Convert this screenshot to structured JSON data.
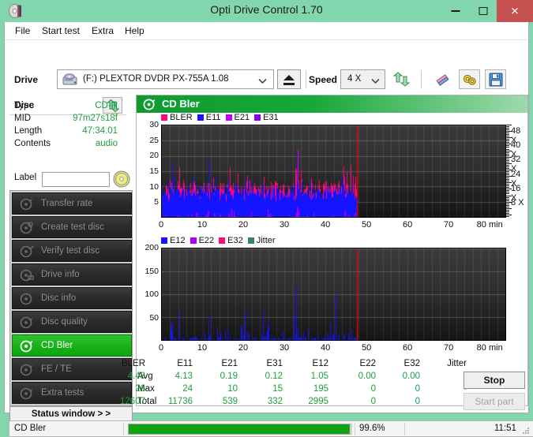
{
  "window": {
    "title": "Opti Drive Control 1.70",
    "icon": "disc-icon",
    "controls": {
      "minimize": "minimize-icon",
      "maximize": "maximize-icon",
      "close": "close-icon"
    },
    "titlebar_color": "#82d6ad",
    "close_color": "#c75050"
  },
  "menu": [
    {
      "label": "File"
    },
    {
      "label": "Start test"
    },
    {
      "label": "Extra"
    },
    {
      "label": "Help"
    }
  ],
  "toolbar": {
    "drive_label": "Drive",
    "drive_value": "(F:)   PLEXTOR DVDR   PX-755A 1.08",
    "drive_icon": "drive-icon",
    "eject_icon": "eject-icon",
    "speed_label": "Speed",
    "speed_value": "4 X",
    "refresh_icon": "refresh-icon",
    "erase_icon": "erase-icon",
    "settings_icon": "settings-icon",
    "save_icon": "save-icon"
  },
  "disc": {
    "header": "Disc",
    "swap_icon": "swap-icon",
    "rows": [
      {
        "key": "Type",
        "value": "CD-R"
      },
      {
        "key": "MID",
        "value": "97m27s18f"
      },
      {
        "key": "Length",
        "value": "47:34.01"
      },
      {
        "key": "Contents",
        "value": "audio"
      }
    ],
    "label_key": "Label",
    "label_value": "",
    "label_placeholder": "",
    "label_button_icon": "cd-icon"
  },
  "nav": {
    "items": [
      {
        "label": "Transfer rate",
        "icon": "disc-icon",
        "active": false
      },
      {
        "label": "Create test disc",
        "icon": "disc-icon",
        "active": false
      },
      {
        "label": "Verify test disc",
        "icon": "disc-icon",
        "active": false
      },
      {
        "label": "Drive info",
        "icon": "disc-icon",
        "active": false
      },
      {
        "label": "Disc info",
        "icon": "disc-icon",
        "active": false
      },
      {
        "label": "Disc quality",
        "icon": "disc-icon",
        "active": false
      },
      {
        "label": "CD Bler",
        "icon": "disc-icon",
        "active": true
      },
      {
        "label": "FE / TE",
        "icon": "disc-icon",
        "active": false
      },
      {
        "label": "Extra tests",
        "icon": "disc-icon",
        "active": false
      }
    ],
    "status_window": "Status window > >"
  },
  "panel": {
    "title": "CD Bler",
    "icon": "disc-icon"
  },
  "chart_data": [
    {
      "id": "bler-chart",
      "type": "line",
      "title": "CD Bler",
      "xlabel": "80 min",
      "ylabel": "",
      "xlim": [
        0,
        84
      ],
      "ylim": [
        0,
        30
      ],
      "xticks": [
        0,
        10,
        20,
        30,
        40,
        50,
        60,
        70,
        80
      ],
      "xticklabels": [
        "0",
        "10",
        "20",
        "30",
        "40",
        "50",
        "60",
        "70",
        "80 min"
      ],
      "yticks": [
        5,
        10,
        15,
        20,
        25,
        30
      ],
      "yticklabels": [
        "5",
        "10",
        "15",
        "20",
        "25",
        "30"
      ],
      "right_axis": {
        "label": "speed",
        "ticks": [
          8,
          16,
          24,
          32,
          40,
          48
        ],
        "ticklabels": [
          "8 X",
          "16 X",
          "24 X",
          "32 X",
          "40 X",
          "48 X"
        ],
        "lim": [
          0,
          52
        ]
      },
      "grid": true,
      "legend": [
        {
          "name": "BLER",
          "color": "#ff0a78"
        },
        {
          "name": "E11",
          "color": "#1414ff"
        },
        {
          "name": "E21",
          "color": "#c000ff"
        },
        {
          "name": "E31",
          "color": "#8800ee"
        }
      ],
      "data_end_min": 47.6,
      "end_marker_color": "#ff0000",
      "series": [
        {
          "name": "BLER",
          "color": "#ff0a78",
          "baseline_mean": 9.5,
          "peaks": [
            [
              1.2,
              12
            ],
            [
              1.9,
              15
            ],
            [
              2.4,
              21
            ],
            [
              2.8,
              18
            ],
            [
              3.6,
              14
            ],
            [
              4.3,
              23
            ],
            [
              5.2,
              13
            ],
            [
              6.1,
              12
            ],
            [
              7.4,
              14
            ],
            [
              7.9,
              13
            ],
            [
              8.6,
              12
            ],
            [
              9.4,
              11
            ],
            [
              10.2,
              14
            ],
            [
              11.3,
              25
            ],
            [
              11.9,
              17
            ],
            [
              12.5,
              18
            ],
            [
              13.4,
              13
            ],
            [
              14.2,
              12
            ],
            [
              15.1,
              14
            ],
            [
              15.8,
              13
            ],
            [
              16.6,
              17
            ],
            [
              17.3,
              20
            ],
            [
              17.9,
              15
            ],
            [
              18.6,
              22
            ],
            [
              19.4,
              14
            ],
            [
              20.2,
              15
            ],
            [
              20.9,
              18
            ],
            [
              21.5,
              19
            ],
            [
              22.3,
              13
            ],
            [
              23.1,
              12
            ],
            [
              24.2,
              16
            ],
            [
              24.9,
              14
            ],
            [
              25.6,
              16
            ],
            [
              26.2,
              15
            ],
            [
              27.1,
              12
            ],
            [
              28.0,
              11
            ],
            [
              29.3,
              12
            ],
            [
              30.4,
              13
            ],
            [
              31.2,
              14
            ],
            [
              32.0,
              16
            ],
            [
              32.6,
              20
            ],
            [
              32.9,
              26
            ],
            [
              33.2,
              24
            ],
            [
              33.5,
              21
            ],
            [
              34.0,
              17
            ],
            [
              34.8,
              12
            ],
            [
              35.6,
              11
            ],
            [
              36.5,
              13
            ],
            [
              37.4,
              11
            ],
            [
              38.2,
              10
            ],
            [
              39.5,
              12
            ],
            [
              40.6,
              12
            ],
            [
              41.3,
              13
            ],
            [
              42.4,
              14
            ],
            [
              43.1,
              11
            ],
            [
              44.5,
              32
            ],
            [
              45.2,
              16
            ],
            [
              46.1,
              24
            ],
            [
              46.8,
              22
            ],
            [
              47.3,
              14
            ]
          ]
        },
        {
          "name": "E11",
          "color": "#1414ff",
          "baseline_mean": 8.5,
          "peaks": [
            [
              1.1,
              11
            ],
            [
              2.2,
              20
            ],
            [
              2.5,
              19
            ],
            [
              3.1,
              14
            ],
            [
              4.0,
              13
            ],
            [
              5.0,
              12
            ],
            [
              6.3,
              11
            ],
            [
              7.5,
              16
            ],
            [
              8.2,
              14
            ],
            [
              9.1,
              12
            ],
            [
              10.4,
              13
            ],
            [
              11.4,
              19
            ],
            [
              12.2,
              14
            ],
            [
              13.1,
              16
            ],
            [
              14.0,
              12
            ],
            [
              15.3,
              13
            ],
            [
              16.2,
              14
            ],
            [
              17.1,
              13
            ],
            [
              18.2,
              15
            ],
            [
              19.0,
              13
            ],
            [
              20.3,
              14
            ],
            [
              21.2,
              16
            ],
            [
              22.0,
              12
            ],
            [
              23.5,
              11
            ],
            [
              24.5,
              13
            ],
            [
              25.4,
              12
            ],
            [
              26.0,
              14
            ],
            [
              27.3,
              11
            ],
            [
              28.6,
              10
            ],
            [
              30.0,
              11
            ],
            [
              31.5,
              12
            ],
            [
              32.4,
              14
            ],
            [
              33.0,
              24
            ],
            [
              33.3,
              22
            ],
            [
              34.2,
              13
            ],
            [
              35.0,
              11
            ],
            [
              36.3,
              12
            ],
            [
              37.1,
              11
            ],
            [
              38.4,
              10
            ],
            [
              40.0,
              11
            ],
            [
              41.1,
              12
            ],
            [
              42.6,
              13
            ],
            [
              44.0,
              16
            ],
            [
              45.5,
              12
            ],
            [
              46.5,
              14
            ],
            [
              47.2,
              11
            ]
          ]
        },
        {
          "name": "E21",
          "color": "#c000ff",
          "baseline_mean": 0.19,
          "peaks": [
            [
              11.3,
              4
            ],
            [
              17.0,
              3
            ],
            [
              17.5,
              3
            ],
            [
              25.9,
              3
            ],
            [
              33.1,
              6
            ],
            [
              33.3,
              5
            ],
            [
              44.8,
              2
            ]
          ]
        },
        {
          "name": "E31",
          "color": "#8800ee",
          "baseline_mean": 0.12,
          "peaks": [
            [
              11.2,
              2
            ],
            [
              16.8,
              2
            ],
            [
              33.2,
              3
            ],
            [
              44.6,
              2
            ]
          ]
        }
      ]
    },
    {
      "id": "e12-chart",
      "type": "line",
      "title": "",
      "xlabel": "80 min",
      "ylabel": "",
      "xlim": [
        0,
        84
      ],
      "ylim": [
        0,
        200
      ],
      "xticks": [
        0,
        10,
        20,
        30,
        40,
        50,
        60,
        70,
        80
      ],
      "xticklabels": [
        "0",
        "10",
        "20",
        "30",
        "40",
        "50",
        "60",
        "70",
        "80 min"
      ],
      "yticks": [
        50,
        100,
        150,
        200
      ],
      "yticklabels": [
        "50",
        "100",
        "150",
        "200"
      ],
      "grid": true,
      "legend": [
        {
          "name": "E12",
          "color": "#1414ff"
        },
        {
          "name": "E22",
          "color": "#a800ff"
        },
        {
          "name": "E32",
          "color": "#ff0a78"
        },
        {
          "name": "Jitter",
          "color": "#3d7d78"
        }
      ],
      "data_end_min": 47.6,
      "end_marker_color": "#ff0000",
      "series": [
        {
          "name": "E12",
          "color": "#1414ff",
          "baseline_mean": 2,
          "peaks": [
            [
              2.2,
              66
            ],
            [
              2.5,
              40
            ],
            [
              3.0,
              10
            ],
            [
              4.3,
              88
            ],
            [
              5.1,
              6
            ],
            [
              7.6,
              12
            ],
            [
              8.2,
              14
            ],
            [
              8.6,
              6
            ],
            [
              9.5,
              8
            ],
            [
              10.4,
              18
            ],
            [
              11.4,
              54
            ],
            [
              11.8,
              12
            ],
            [
              12.8,
              6
            ],
            [
              13.5,
              30
            ],
            [
              14.2,
              26
            ],
            [
              14.9,
              6
            ],
            [
              15.4,
              27
            ],
            [
              16.0,
              26
            ],
            [
              16.6,
              8
            ],
            [
              18.1,
              4
            ],
            [
              19.4,
              65
            ],
            [
              19.9,
              12
            ],
            [
              20.3,
              74
            ],
            [
              20.8,
              26
            ],
            [
              21.2,
              20
            ],
            [
              22.0,
              5
            ],
            [
              23.0,
              6
            ],
            [
              24.3,
              14
            ],
            [
              24.7,
              72
            ],
            [
              25.2,
              18
            ],
            [
              25.8,
              54
            ],
            [
              26.1,
              52
            ],
            [
              26.6,
              8
            ],
            [
              28.4,
              6
            ],
            [
              29.5,
              28
            ],
            [
              31.0,
              6
            ],
            [
              32.3,
              80
            ],
            [
              32.7,
              22
            ],
            [
              32.9,
              194
            ],
            [
              33.2,
              30
            ],
            [
              33.5,
              10
            ],
            [
              34.0,
              12
            ],
            [
              34.6,
              24
            ],
            [
              35.7,
              28
            ],
            [
              36.8,
              6
            ],
            [
              38.0,
              14
            ],
            [
              39.5,
              6
            ],
            [
              40.5,
              22
            ],
            [
              41.1,
              44
            ],
            [
              41.8,
              26
            ],
            [
              42.5,
              110
            ],
            [
              43.2,
              20
            ],
            [
              44.5,
              26
            ],
            [
              45.6,
              18
            ],
            [
              46.3,
              30
            ],
            [
              47.0,
              12
            ]
          ]
        },
        {
          "name": "E22",
          "color": "#a800ff",
          "baseline_mean": 0,
          "peaks": []
        },
        {
          "name": "E32",
          "color": "#ff0a78",
          "baseline_mean": 0,
          "peaks": []
        },
        {
          "name": "Jitter",
          "color": "#3d7d78",
          "baseline_mean": 0,
          "peaks": []
        }
      ]
    }
  ],
  "stats": {
    "columns": [
      "BLER",
      "E11",
      "E21",
      "E31",
      "E12",
      "E22",
      "E32",
      "Jitter"
    ],
    "rows": [
      {
        "label": "Avg",
        "values": [
          "4.43",
          "4.13",
          "0.19",
          "0.12",
          "1.05",
          "0.00",
          "0.00",
          "-"
        ]
      },
      {
        "label": "Max",
        "values": [
          "26",
          "24",
          "10",
          "15",
          "195",
          "0",
          "0",
          "-"
        ]
      },
      {
        "label": "Total",
        "values": [
          "12607",
          "11736",
          "539",
          "332",
          "2995",
          "0",
          "0",
          ""
        ]
      }
    ]
  },
  "actions": {
    "stop": "Stop",
    "start_part": "Start part"
  },
  "statusbar": {
    "text": "CD Bler",
    "progress_percent": 99.6,
    "progress_label": "99.6%",
    "time": "11:51",
    "progress_color": "#12a312"
  }
}
